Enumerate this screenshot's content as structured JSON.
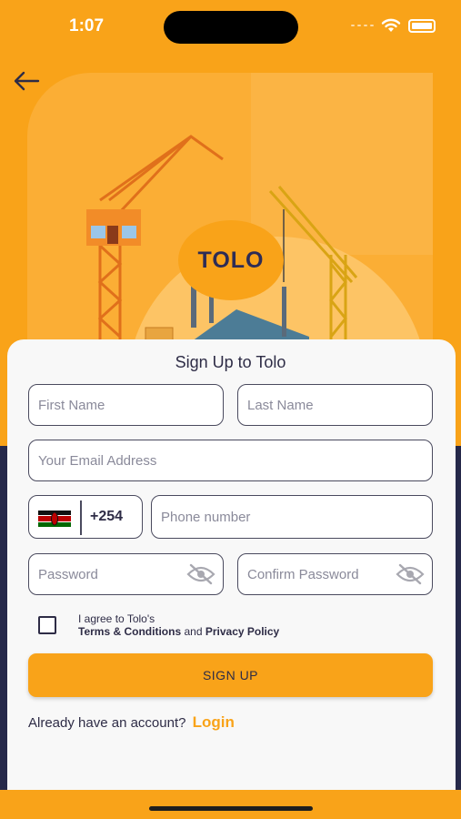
{
  "status": {
    "time": "1:07"
  },
  "hero": {
    "logo_text": "TOLO"
  },
  "form": {
    "title": "Sign Up to Tolo",
    "first_name_placeholder": "First Name",
    "last_name_placeholder": "Last Name",
    "email_placeholder": "Your Email Address",
    "country_code": "+254",
    "phone_placeholder": "Phone number",
    "password_placeholder": "Password",
    "confirm_password_placeholder": "Confirm Password",
    "agree_line1": "I agree to Tolo's",
    "terms_label": "Terms & Conditions",
    "and_text": "and",
    "privacy_label": "Privacy Policy",
    "signup_label": "SIGN UP",
    "have_account_text": "Already have an account?",
    "login_label": "Login"
  },
  "colors": {
    "accent": "#F9A319",
    "navy": "#26294A",
    "text": "#2E2C46"
  },
  "icons": [
    "back-arrow-icon",
    "wifi-icon",
    "signal-icon",
    "battery-icon",
    "eye-off-icon",
    "kenya-flag-icon"
  ]
}
